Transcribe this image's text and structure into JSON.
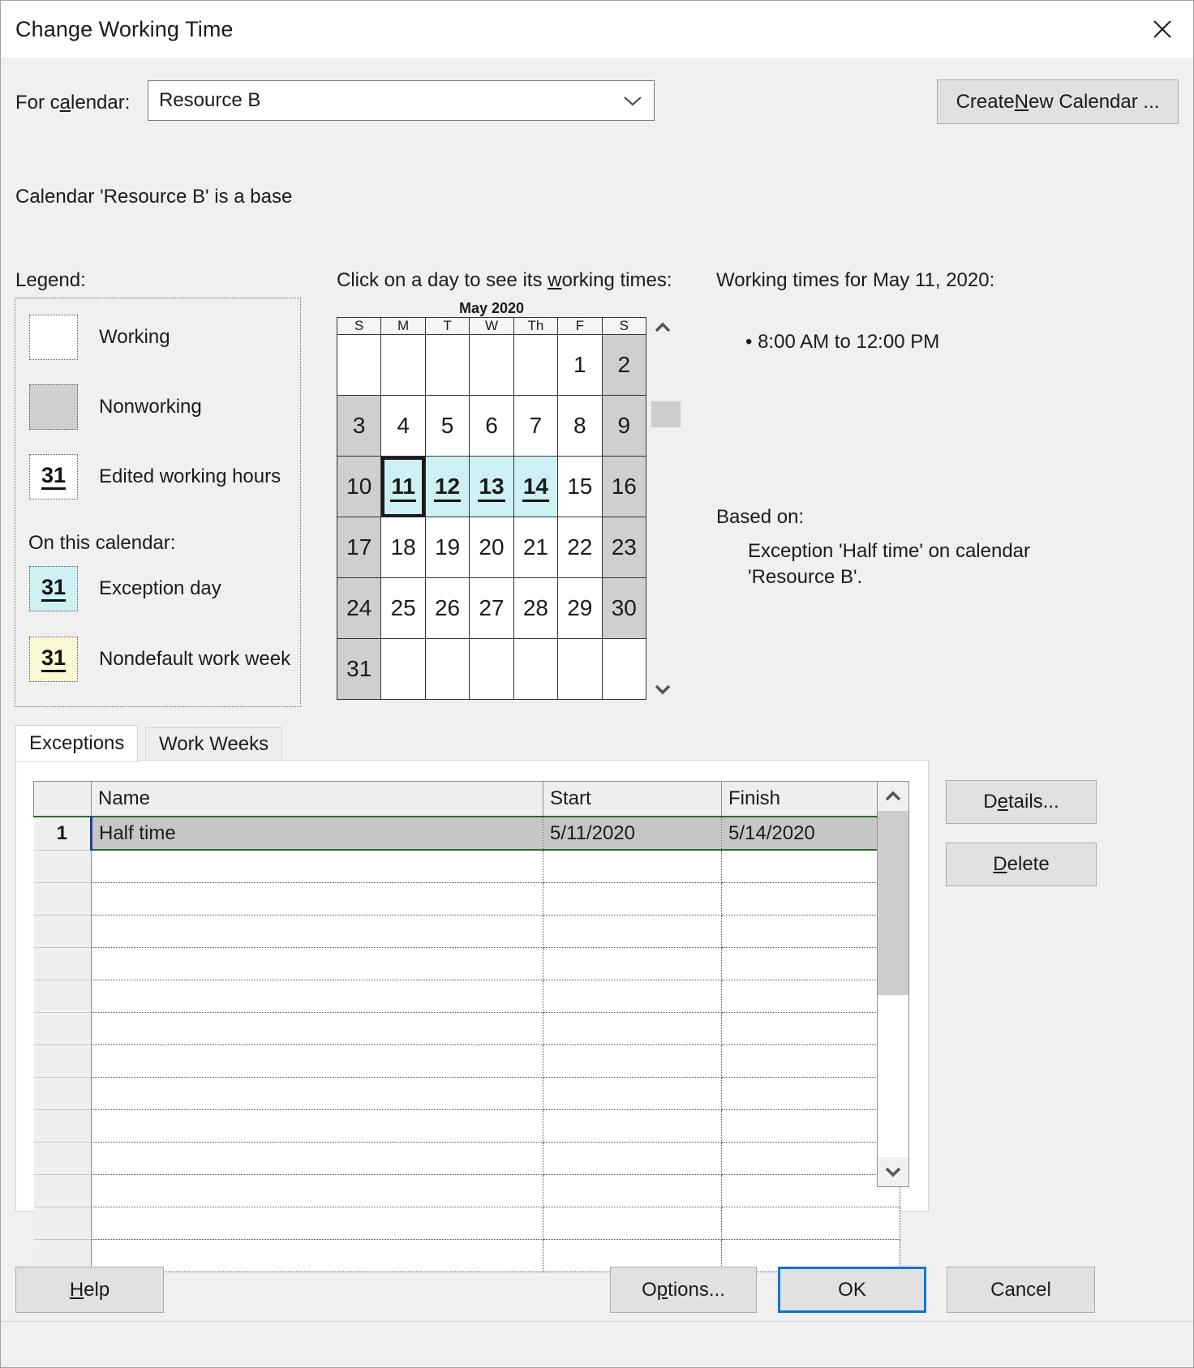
{
  "window": {
    "title": "Change Working Time",
    "close_icon": "close-icon"
  },
  "calendar_selector": {
    "label_pre": "For c",
    "label_accel": "a",
    "label_post": "lendar:",
    "value": "Resource B",
    "chevron_icon": "chevron-down-icon",
    "create_new_pre": "Create ",
    "create_new_accel": "N",
    "create_new_post": "ew Calendar ...",
    "base_note": "Calendar 'Resource B' is a base"
  },
  "legend": {
    "title": "Legend:",
    "items": [
      {
        "label": "Working",
        "swatch": "",
        "color": "#ffffff"
      },
      {
        "label": "Nonworking",
        "swatch": "",
        "color": "#cfcfcf"
      },
      {
        "label": "Edited working hours",
        "swatch": "31",
        "color": "#ffffff"
      }
    ],
    "on_this_calendar": "On this calendar:",
    "cal_items": [
      {
        "label": "Exception day",
        "swatch": "31",
        "color": "#cdf0f5"
      },
      {
        "label": "Nondefault work week",
        "swatch": "31",
        "color": "#fbf8d4"
      }
    ]
  },
  "calendar": {
    "hint_pre": "Click on a day to see its ",
    "hint_accel": "w",
    "hint_post": "orking times:",
    "month_label": "May 2020",
    "weekday_headers": [
      "S",
      "M",
      "T",
      "W",
      "Th",
      "F",
      "S"
    ],
    "weeks": [
      [
        {
          "n": "",
          "state": "blank"
        },
        {
          "n": "",
          "state": "blank"
        },
        {
          "n": "",
          "state": "blank"
        },
        {
          "n": "",
          "state": "blank"
        },
        {
          "n": "",
          "state": "blank"
        },
        {
          "n": "1",
          "state": "working"
        },
        {
          "n": "2",
          "state": "nonworking"
        }
      ],
      [
        {
          "n": "3",
          "state": "nonworking"
        },
        {
          "n": "4",
          "state": "working"
        },
        {
          "n": "5",
          "state": "working"
        },
        {
          "n": "6",
          "state": "working"
        },
        {
          "n": "7",
          "state": "working"
        },
        {
          "n": "8",
          "state": "working"
        },
        {
          "n": "9",
          "state": "nonworking"
        }
      ],
      [
        {
          "n": "10",
          "state": "nonworking"
        },
        {
          "n": "11",
          "state": "exception",
          "selected": true
        },
        {
          "n": "12",
          "state": "exception"
        },
        {
          "n": "13",
          "state": "exception"
        },
        {
          "n": "14",
          "state": "exception"
        },
        {
          "n": "15",
          "state": "working"
        },
        {
          "n": "16",
          "state": "nonworking"
        }
      ],
      [
        {
          "n": "17",
          "state": "nonworking"
        },
        {
          "n": "18",
          "state": "working"
        },
        {
          "n": "19",
          "state": "working"
        },
        {
          "n": "20",
          "state": "working"
        },
        {
          "n": "21",
          "state": "working"
        },
        {
          "n": "22",
          "state": "working"
        },
        {
          "n": "23",
          "state": "nonworking"
        }
      ],
      [
        {
          "n": "24",
          "state": "nonworking"
        },
        {
          "n": "25",
          "state": "working"
        },
        {
          "n": "26",
          "state": "working"
        },
        {
          "n": "27",
          "state": "working"
        },
        {
          "n": "28",
          "state": "working"
        },
        {
          "n": "29",
          "state": "working"
        },
        {
          "n": "30",
          "state": "nonworking"
        }
      ],
      [
        {
          "n": "31",
          "state": "nonworking"
        },
        {
          "n": "",
          "state": "blank"
        },
        {
          "n": "",
          "state": "blank"
        },
        {
          "n": "",
          "state": "blank"
        },
        {
          "n": "",
          "state": "blank"
        },
        {
          "n": "",
          "state": "blank"
        },
        {
          "n": "",
          "state": "blank"
        }
      ]
    ],
    "scroll_up_icon": "chevron-up-icon",
    "scroll_down_icon": "chevron-down-icon"
  },
  "working_times": {
    "title": "Working times for May 11, 2020:",
    "entries": [
      "8:00 AM to 12:00 PM"
    ],
    "based_on_title": "Based on:",
    "based_on_text": "Exception 'Half time' on calendar 'Resource B'."
  },
  "tabs": [
    {
      "label": "Exceptions",
      "active": true
    },
    {
      "label": "Work Weeks",
      "active": false
    }
  ],
  "grid": {
    "columns": [
      "Name",
      "Start",
      "Finish"
    ],
    "rows": [
      {
        "index": "1",
        "name": "Half time",
        "start": "5/11/2020",
        "finish": "5/14/2020",
        "selected": true
      }
    ],
    "empty_row_count": 13,
    "scroll_up_icon": "chevron-up-icon",
    "scroll_down_icon": "chevron-down-icon"
  },
  "side_buttons": {
    "details_pre": "D",
    "details_accel": "e",
    "details_post": "tails...",
    "delete_pre": "",
    "delete_accel": "D",
    "delete_post": "elete"
  },
  "footer": {
    "help_pre": "",
    "help_accel": "H",
    "help_post": "elp",
    "options_pre": "O",
    "options_accel": "p",
    "options_post": "tions...",
    "ok": "OK",
    "cancel": "Cancel"
  },
  "colors": {
    "accent": "#0078d4",
    "nonworking": "#cfcfcf",
    "exception": "#cdf0f5",
    "nondefault_week": "#fbf8d4",
    "selected_row": "#c6c6c6",
    "grid_sel_border": "#2e6b2e"
  }
}
